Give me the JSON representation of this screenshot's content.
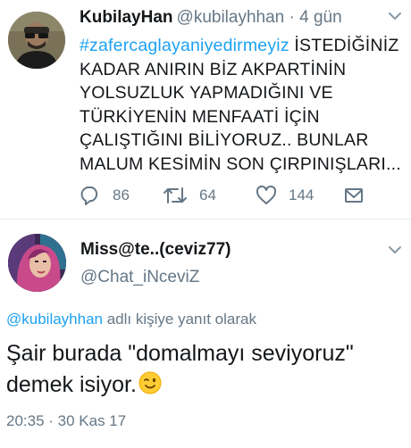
{
  "tweet1": {
    "author_name": "KubilayHan",
    "author_handle": "@kubilayhhan",
    "separator": "·",
    "time_ago": "4 gün",
    "hashtag": "#zafercaglayaniyedirmeyiz",
    "text": " İSTEDİĞİNİZ KADAR ANIRIN BİZ AKPARTİNİN YOLSUZLUK YAPMADIĞINI VE TÜRKİYENİN MENFAATİ İÇİN ÇALIŞTIĞINI BİLİYORUZ.. BUNLAR MALUM KESİMİN SON ÇIRPINIŞLARI...",
    "replies": "86",
    "retweets": "64",
    "likes": "144"
  },
  "tweet2": {
    "author_name": "Miss@te..(ceviz77)",
    "author_handle": "@Chat_iNceviZ",
    "reply_mention": "@kubilayhhan",
    "reply_suffix": " adlı kişiye yanıt olarak",
    "text": "Şair burada \"domalmayı seviyoruz\" demek isiyor.",
    "emoji": "winking-smiley-emoji",
    "timestamp": "20:35 · 30 Kas 17"
  },
  "colors": {
    "link": "#1da1f2",
    "secondary_text": "#657786",
    "primary_text": "#14171a",
    "divider": "#e6ecf0"
  },
  "icons": {
    "reply": "reply-icon",
    "retweet": "retweet-icon",
    "like": "heart-icon",
    "dm": "envelope-icon",
    "menu": "chevron-down-icon"
  }
}
